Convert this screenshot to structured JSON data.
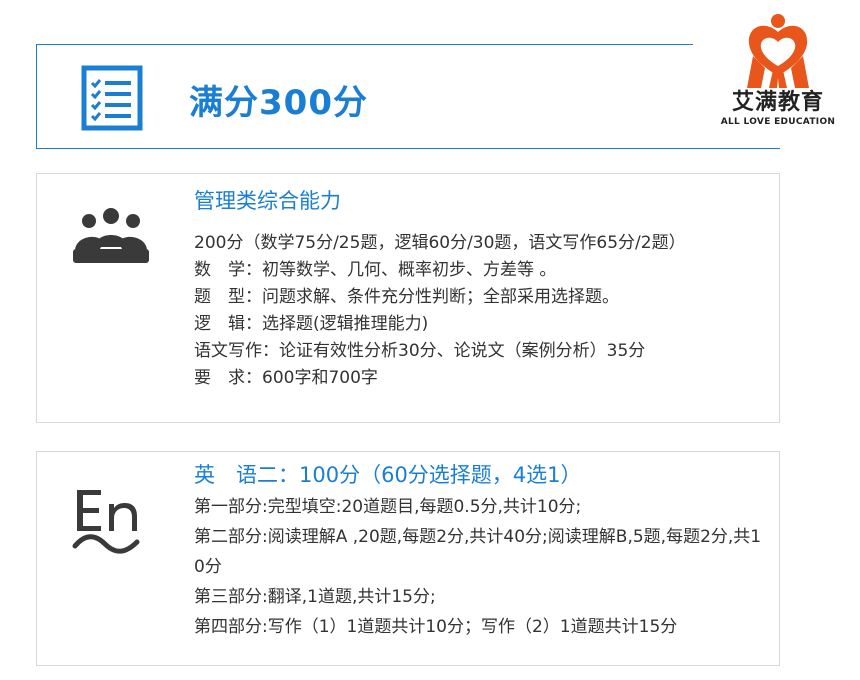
{
  "header": {
    "title": "满分300分",
    "icon": "checklist-icon",
    "accent_color": "#1a7fd4"
  },
  "logo": {
    "name": "艾满教育",
    "subtitle": "ALL LOVE EDUCATION",
    "mark_icon": "heart-people-icon",
    "mark_color": "#e8561c"
  },
  "section_management": {
    "icon": "group-meeting-icon",
    "title": "管理类综合能力",
    "lines": [
      "200分（数学75分/25题，逻辑60分/30题，语文写作65分/2题）",
      "数　学：初等数学、几何、概率初步、方差等 。",
      "题　型：问题求解、条件充分性判断；全部采用选择题。",
      "逻　辑：选择题(逻辑推理能力)",
      "语文写作：论证有效性分析30分、论说文（案例分析）35分",
      "要　求：600字和700字"
    ]
  },
  "section_english": {
    "icon": "english-en-icon",
    "title": "英　语二：100分（60分选择题，4选1）",
    "lines": [
      "第一部分:完型填空:20道题目,每题0.5分,共计10分;",
      "第二部分:阅读理解A ,20题,每题2分,共计40分;阅读理解B,5题,每题2分,共10分",
      "第三部分:翻译,1道题,共计15分;",
      "第四部分:写作（1）1道题共计10分；写作（2）1道题共计15分"
    ]
  }
}
